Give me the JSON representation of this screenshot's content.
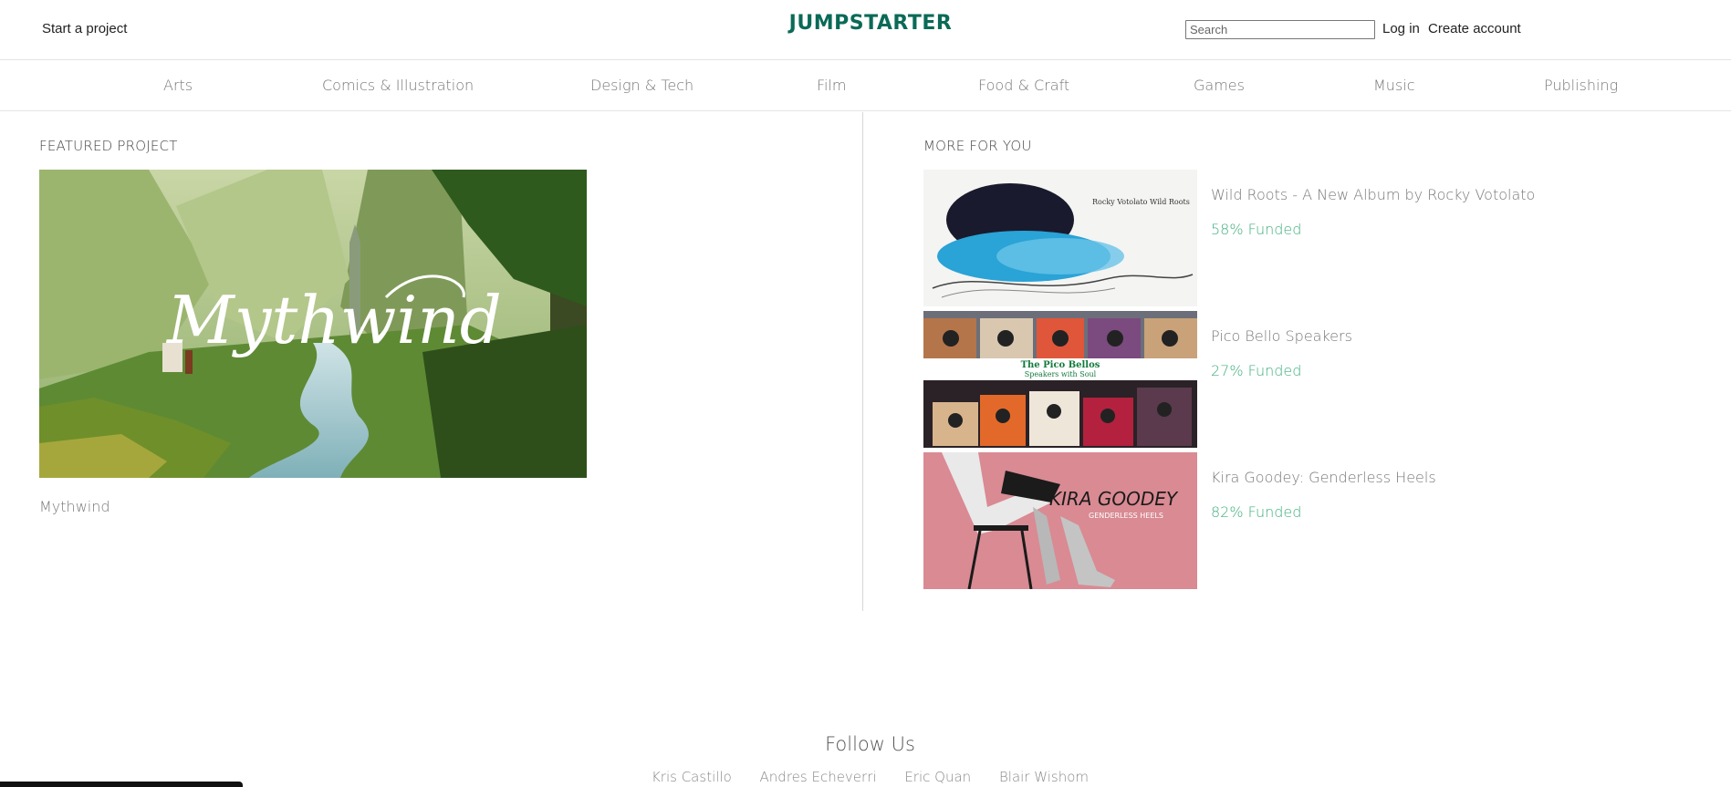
{
  "header": {
    "start_project": "Start a project",
    "logo": "JUMPSTARTER",
    "search_placeholder": "Search",
    "login": "Log in",
    "create_account": "Create account"
  },
  "categories": [
    "Arts",
    "Comics & Illustration",
    "Design & Tech",
    "Film",
    "Food & Craft",
    "Games",
    "Music",
    "Publishing"
  ],
  "featured": {
    "section_title": "FEATURED PROJECT",
    "image_wordmark": "Mythwind",
    "name": "Mythwind"
  },
  "more_for_you": {
    "section_title": "MORE FOR YOU",
    "items": [
      {
        "title": "Wild Roots - A New Album by Rocky Votolato",
        "funded": "58% Funded",
        "thumb_caption": "Rocky Votolato\nWild Roots"
      },
      {
        "title": "Pico Bello Speakers",
        "funded": "27% Funded",
        "thumb_caption_1": "The Pico Bellos",
        "thumb_caption_2": "Speakers with Soul"
      },
      {
        "title": "Kira Goodey: Genderless Heels",
        "funded": "82% Funded",
        "thumb_caption_1": "KIRA GOODEY",
        "thumb_caption_2": "GENDERLESS HEELS"
      }
    ]
  },
  "footer": {
    "follow_title": "Follow Us",
    "people": [
      "Kris Castillo",
      "Andres Echeverri",
      "Eric Quan",
      "Blair Wishom"
    ]
  },
  "colors": {
    "brand": "#0a6a57",
    "funded": "#3fae7e",
    "muted_text": "#777777"
  }
}
